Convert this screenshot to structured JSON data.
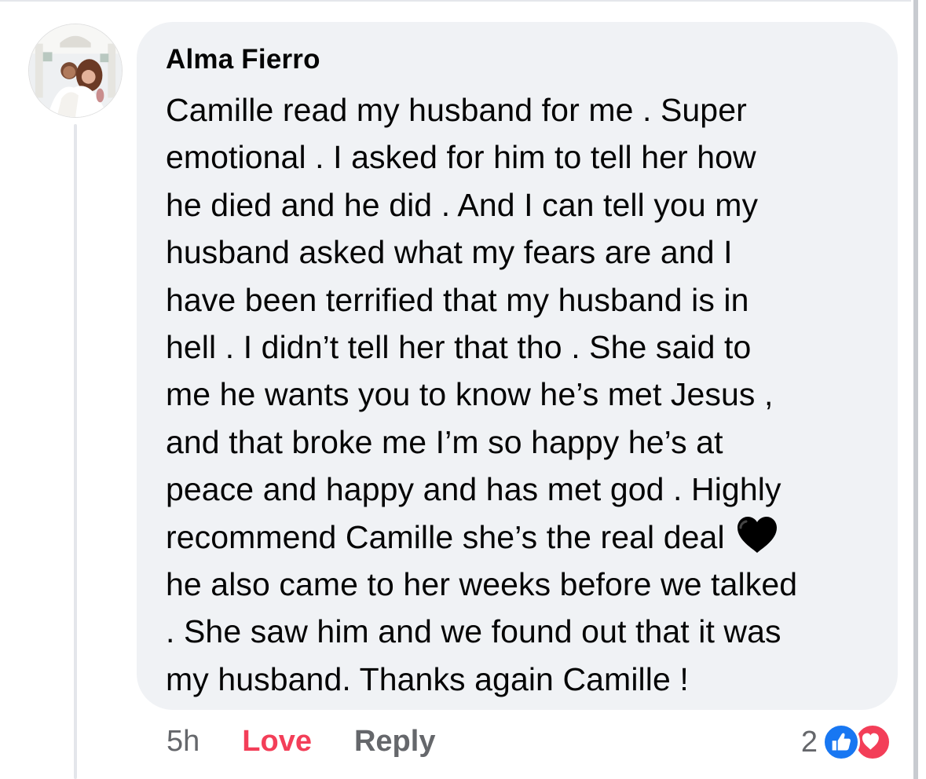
{
  "comment": {
    "author": "Alma Fierro",
    "text": "Camille read my husband for me . Super\nemotional . I asked for him to tell her how\nhe died and he did . And I can tell you my\nhusband asked what my fears are and I\nhave been terrified that my husband is in\nhell . I didn’t tell her that tho . She said to\nme he wants you to know he’s met Jesus ,\nand that broke me I’m so happy he’s at\npeace and happy and has met god . Highly\nrecommend Camille she’s the real deal ",
    "text_after_emoji": "\nhe also came to her weeks before we talked\n. She saw him and we found out that it was\nmy husband. Thanks again Camille !",
    "emoji": "black-heart-icon"
  },
  "actions": {
    "time": "5h",
    "love_label": "Love",
    "reply_label": "Reply"
  },
  "reactions": {
    "count": "2",
    "types": [
      "like-icon",
      "love-icon"
    ]
  },
  "colors": {
    "bubble": "#f0f2f5",
    "love": "#f33e58",
    "like": "#1877f2",
    "muted": "#65676b",
    "text": "#050505"
  }
}
